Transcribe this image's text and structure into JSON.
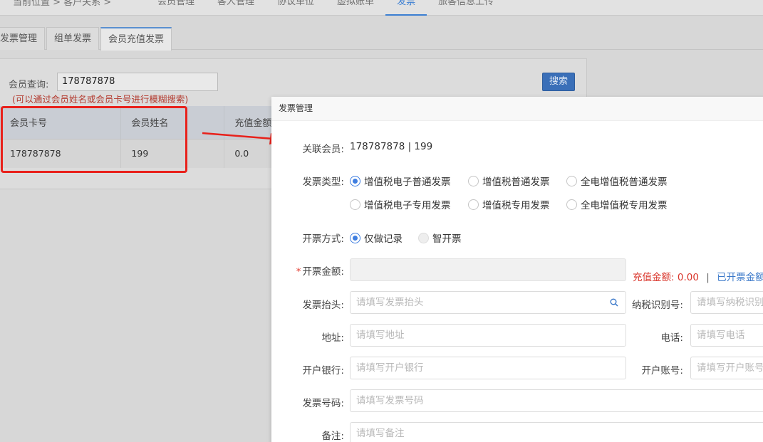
{
  "topbar": {
    "breadcrumb": "当前位置 > 客户关系 >",
    "nav": [
      "会员管理",
      "客人管理",
      "协议单位",
      "虚拟账单",
      "发票",
      "旅客信息上传"
    ],
    "active_nav": "发票"
  },
  "subtabs": [
    "发票管理",
    "组单发票",
    "会员充值发票"
  ],
  "search": {
    "label": "会员查询:",
    "value": "178787878",
    "hint": "(可以通过会员姓名或会员卡号进行模糊搜索)",
    "button": "搜索"
  },
  "table": {
    "headers": [
      "会员卡号",
      "会员姓名",
      "充值金额"
    ],
    "rows": [
      [
        "178787878",
        "199",
        "0.0"
      ]
    ]
  },
  "modal": {
    "title": "发票管理",
    "member_label": "关联会员:",
    "member_value": "178787878 | 199",
    "invoice_type_label": "发票类型:",
    "invoice_types": [
      "增值税电子普通发票",
      "增值税普通发票",
      "全电增值税普通发票",
      "增值税电子专用发票",
      "增值税专用发票",
      "全电增值税专用发票"
    ],
    "invoice_type_selected": "增值税电子普通发票",
    "issue_method_label": "开票方式:",
    "issue_methods": [
      "仅做记录",
      "智开票"
    ],
    "issue_method_selected": "仅做记录",
    "amount_label": "开票金额:",
    "recharge_label": "充值金额:",
    "recharge_value": "0.00",
    "issued_label": "已开票金额",
    "title_field_label": "发票抬头:",
    "title_field_placeholder": "请填写发票抬头",
    "tax_id_label": "纳税识别号:",
    "tax_id_placeholder": "请填写纳税识别号",
    "address_label": "地址:",
    "address_placeholder": "请填写地址",
    "phone_label": "电话:",
    "phone_placeholder": "请填写电话",
    "bank_label": "开户银行:",
    "bank_placeholder": "请填写开户银行",
    "account_label": "开户账号:",
    "account_placeholder": "请填写开户账号",
    "invoice_no_label": "发票号码:",
    "invoice_no_placeholder": "请填写发票号码",
    "remark_label": "备注:",
    "remark_placeholder": "请填写备注"
  },
  "colors": {
    "accent": "#3f7ee0",
    "highlight_box": "#e8211b",
    "required": "#e23b2f"
  }
}
